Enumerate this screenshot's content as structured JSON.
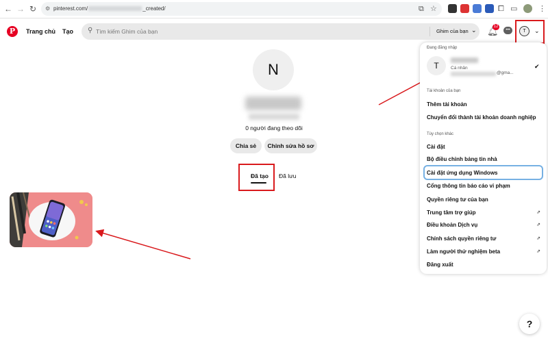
{
  "browser": {
    "url_prefix": "pinterest.com/",
    "url_suffix": "_created/"
  },
  "header": {
    "logo": "P",
    "nav_home": "Trang chủ",
    "nav_create": "Tạo",
    "search_placeholder": "Tìm kiếm Ghim của bạn",
    "search_scope": "Ghim của bạn",
    "notification_count": "12",
    "account_initial": "T"
  },
  "profile": {
    "initial": "N",
    "followers": "0 người đang theo dõi",
    "share_button": "Chia sẻ",
    "edit_button": "Chỉnh sửa hồ sơ",
    "tab_created": "Đã tạo",
    "tab_saved": "Đã lưu"
  },
  "dropdown": {
    "logged_in_label": "Đang đăng nhập",
    "account_initial": "T",
    "account_type": "Cá nhân",
    "email_tail": "@gma...",
    "your_accounts_label": "Tài khoản của bạn",
    "add_account": "Thêm tài khoản",
    "convert_business": "Chuyển đổi thành tài khoản doanh nghiệp",
    "more_options_label": "Tùy chọn khác",
    "items": [
      "Cài đặt",
      "Bộ điều chỉnh bảng tin nhà",
      "Cài đặt ứng dụng Windows",
      "Cổng thông tin báo cáo vi phạm",
      "Quyền riêng tư của bạn",
      "Trung tâm trợ giúp",
      "Điều khoản Dịch vụ",
      "Chính sách quyền riêng tư",
      "Làm người thử nghiệm beta",
      "Đăng xuất"
    ]
  },
  "help_button": "?",
  "colors": {
    "brand": "#e60023",
    "annotation": "#d9191c",
    "highlight": "#76b0e3"
  }
}
